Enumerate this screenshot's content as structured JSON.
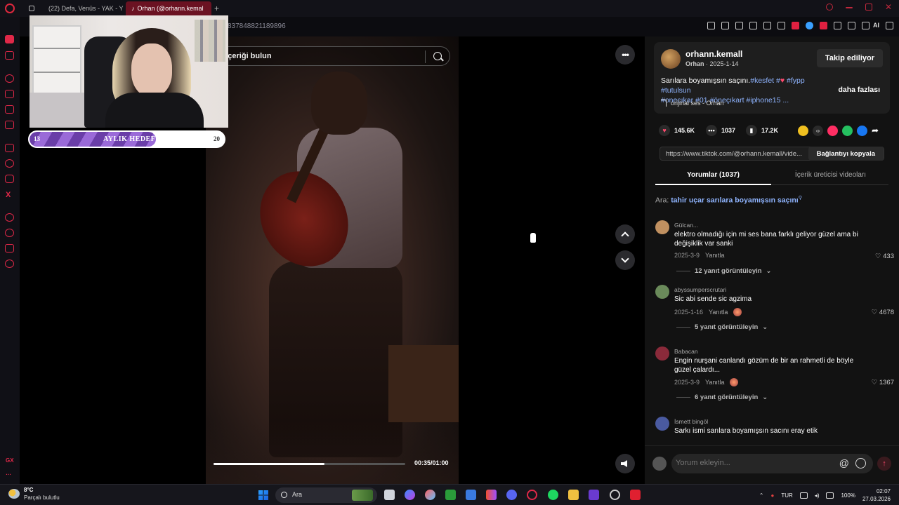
{
  "browser": {
    "tabs": [
      {
        "label": ""
      },
      {
        "label": "(22) Defa, Venüs - YAK - Y"
      },
      {
        "label": "Orhan (@orhann.kemal"
      }
    ],
    "url_fragment": "837848821189896"
  },
  "sidebar": {
    "bottom_label": "GX"
  },
  "webcam": {
    "goal": {
      "title": "AYLIK HEDEF",
      "current": "13",
      "target": "20",
      "progress": 0.65
    }
  },
  "player": {
    "search_placeholder": "ili içeriği bulun",
    "time": "00:35/01:00",
    "progress": 0.58
  },
  "post": {
    "author": "orhann.kemall",
    "display_name": "Orhan",
    "date": "2025-1-14",
    "follow_label": "Takip ediliyor",
    "caption": "Sarılara boyamışsın saçını.",
    "tags_line1": "#kesfet #",
    "tags_line1b": "#fypp #tutulsun",
    "tags_line2": "#onecıkar #01 #öneçıkart #iphone15 ...",
    "more_label": "daha fazlası",
    "sound": "orijinal ses - Orhan",
    "likes": "145.6K",
    "comments_count": "1037",
    "saves": "17.2K",
    "link": "https://www.tiktok.com/@orhann.kemall/vide...",
    "copy_label": "Bağlantıyı kopyala"
  },
  "tabs": {
    "comments": "Yorumlar (1037)",
    "creator_videos": "İçerik üreticisi videoları"
  },
  "search_suggestion": {
    "prefix": "Ara:",
    "query": "tahir uçar sarılara boyamışsın saçını"
  },
  "comments": [
    {
      "user": "Gülcan...",
      "text": "elektro olmadığı için mi ses bana farklı geliyor güzel ama bi değişiklik var sanki",
      "date": "2025-3-9",
      "reply": "Yanıtla",
      "likes": "433",
      "more": "12 yanıt görüntüleyin",
      "avatar_color": "#c09060"
    },
    {
      "user": "abyssumperscrutari",
      "text": "Sic abi sende sic agzima",
      "date": "2025-1-16",
      "reply": "Yanıtla",
      "likes": "4678",
      "more": "5 yanıt görüntüleyin",
      "avatar_color": "#6a8a5a"
    },
    {
      "user": "Babacan",
      "text": "Engin nurşani canlandı gözüm de bir an rahmetli de böyle güzel çalardı...",
      "date": "2025-3-9",
      "reply": "Yanıtla",
      "likes": "1367",
      "more": "6 yanıt görüntüleyin",
      "avatar_color": "#8a2a3a"
    },
    {
      "user": "İsmett bingöl",
      "text": "Sarkı ismi sarılara boyamışsın sacını eray etik",
      "date": "",
      "reply": "",
      "likes": "",
      "more": "",
      "avatar_color": "#4a5aa0"
    }
  ],
  "comment_input": {
    "placeholder": "Yorum ekleyin..."
  },
  "taskbar": {
    "temp": "8°C",
    "weather": "Parçalı bulutlu",
    "search": "Ara",
    "lang": "TUR",
    "battery": "100%",
    "time": "02:07",
    "date": "27.03.2026"
  },
  "colors": {
    "accent": "#e02848",
    "tag": "#8fb4ff",
    "goal_fill": "#6a3ea8"
  }
}
